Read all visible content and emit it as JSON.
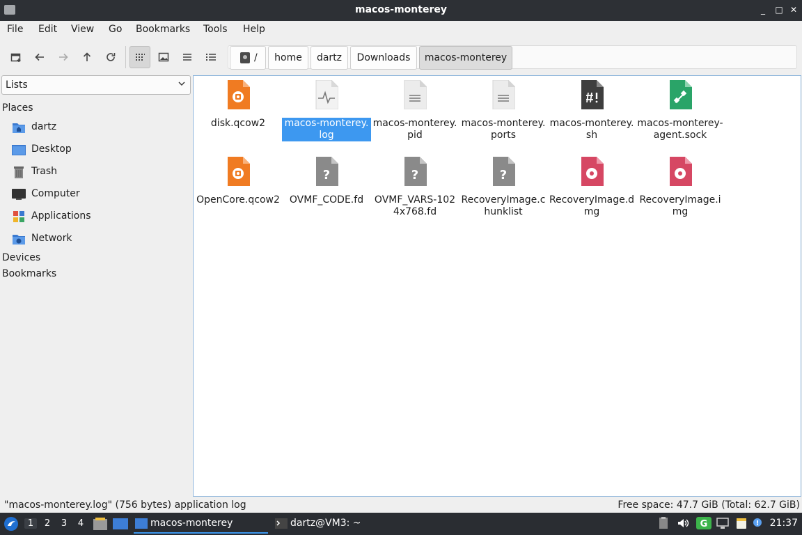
{
  "window": {
    "title": "macos-monterey",
    "controls": [
      "_",
      "□",
      "✕"
    ]
  },
  "menu": [
    "File",
    "Edit",
    "View",
    "Go",
    "Bookmarks",
    "Tools",
    "Help"
  ],
  "toolbar": {
    "buttons": [
      "new-tab-icon",
      "back-icon",
      "forward-icon",
      "up-icon",
      "reload-icon",
      "icon-view-icon",
      "thumbnail-view-icon",
      "compact-view-icon",
      "detailed-list-icon"
    ],
    "path_root": "/",
    "path": [
      "home",
      "dartz",
      "Downloads",
      "macos-monterey"
    ]
  },
  "sidebar": {
    "select_value": "Lists",
    "places_label": "Places",
    "places": [
      "dartz",
      "Desktop",
      "Trash",
      "Computer",
      "Applications",
      "Network"
    ],
    "devices_label": "Devices",
    "bookmarks_label": "Bookmarks"
  },
  "files": [
    {
      "name": "disk.qcow2",
      "icon": "disk-image-orange"
    },
    {
      "name": "macos-monterey.log",
      "icon": "log-file",
      "selected": true
    },
    {
      "name": "macos-monterey.pid",
      "icon": "text-file"
    },
    {
      "name": "macos-monterey.ports",
      "icon": "text-file"
    },
    {
      "name": "macos-monterey.sh",
      "icon": "script-file"
    },
    {
      "name": "macos-monterey-agent.sock",
      "icon": "socket-file"
    },
    {
      "name": "OpenCore.qcow2",
      "icon": "disk-image-orange"
    },
    {
      "name": "OVMF_CODE.fd",
      "icon": "unknown-file"
    },
    {
      "name": "OVMF_VARS-1024x768.fd",
      "icon": "unknown-file"
    },
    {
      "name": "RecoveryImage.chunklist",
      "icon": "unknown-file"
    },
    {
      "name": "RecoveryImage.dmg",
      "icon": "disc-image-red"
    },
    {
      "name": "RecoveryImage.img",
      "icon": "disc-image-red"
    }
  ],
  "status": {
    "left": "\"macos-monterey.log\" (756 bytes) application log",
    "right": "Free space: 47.7 GiB (Total: 62.7 GiB)"
  },
  "panel": {
    "workspaces": [
      "1",
      "2",
      "3",
      "4"
    ],
    "tasks": [
      "macos-monterey",
      "dartz@VM3: ~"
    ],
    "clock": "21:37"
  },
  "colors": {
    "selection": "#3d98f0",
    "titlebar": "#2d3035",
    "orange": "#f07b22",
    "red": "#d64763",
    "green": "#2aa468"
  }
}
